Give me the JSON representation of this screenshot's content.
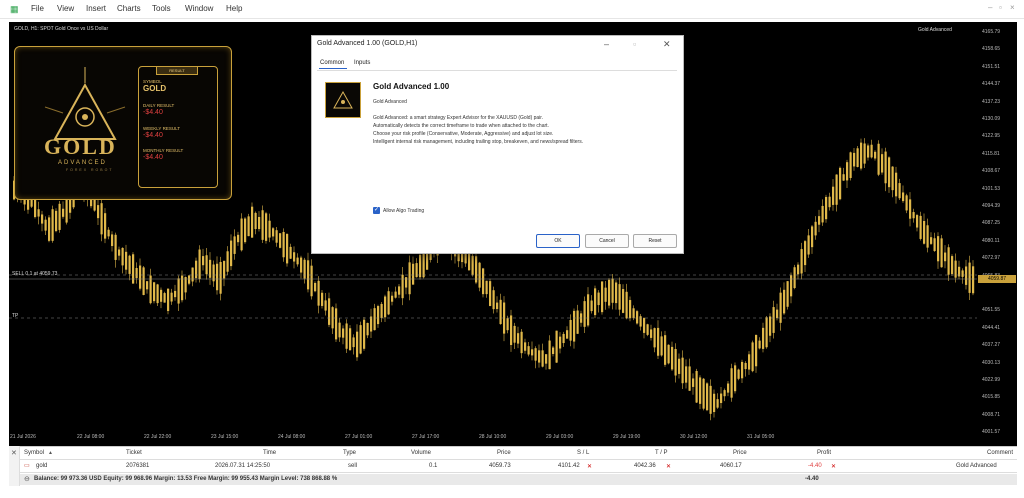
{
  "menu": {
    "items": [
      "File",
      "View",
      "Insert",
      "Charts",
      "Tools",
      "Window",
      "Help"
    ]
  },
  "chart": {
    "title": "GOLD, H1: SPOT Gold Once vs US Dollar",
    "ea_tag": "Gold Advanced",
    "price_labels": [
      "4165.79",
      "4158.65",
      "4151.51",
      "4144.37",
      "4137.23",
      "4130.09",
      "4122.95",
      "4115.81",
      "4108.67",
      "4101.53",
      "4094.39",
      "4087.25",
      "4080.11",
      "4072.97",
      "4065.83",
      "4051.55",
      "4044.41",
      "4037.27",
      "4030.13",
      "4022.99",
      "4015.85",
      "4008.71",
      "4001.57"
    ],
    "current_price": "4059.87",
    "date_labels": [
      "21 Jul 2026",
      "22 Jul 08:00",
      "22 Jul 22:00",
      "23 Jul 15:00",
      "24 Jul 08:00",
      "27 Jul 01:00",
      "27 Jul 17:00",
      "28 Jul 10:00",
      "29 Jul 03:00",
      "29 Jul 19:00",
      "30 Jul 12:00",
      "31 Jul 05:00"
    ],
    "sell_line_label": "SELL 0.1 at 4059.73",
    "tp_label": "TP"
  },
  "overlay": {
    "logo": "GOLD",
    "logo_sub": "ADVANCED",
    "logo_sub2": "FOREX ROBOT",
    "header": "RESULT",
    "symbol_label": "SYMBOL",
    "symbol_value": "GOLD",
    "daily_label": "DAILY RESULT",
    "daily_value": "-$4.40",
    "weekly_label": "WEEKLY RESULT",
    "weekly_value": "-$4.40",
    "monthly_label": "MONTHLY RESULT",
    "monthly_value": "-$4.40"
  },
  "dialog": {
    "title": "Gold Advanced 1.00 (GOLD,H1)",
    "tabs": [
      "Common",
      "Inputs"
    ],
    "ea_name": "Gold Advanced 1.00",
    "ea_sub": "Gold Advanced",
    "description": [
      "Gold Advanced: a smart strategy Expert Advisor for the XAUUSD (Gold) pair.",
      "Automatically detects the correct timeframe to trade when attached to the chart.",
      "Choose your risk profile (Conservative, Moderate, Aggressive) and adjust lot size.",
      "Intelligent internal risk management, including trailing stop, breakeven, and news/spread filters."
    ],
    "allow_algo": "Allow Algo Trading",
    "ok": "OK",
    "cancel": "Cancel",
    "reset": "Reset"
  },
  "trade": {
    "headers": {
      "symbol": "Symbol",
      "ticket": "Ticket",
      "time": "Time",
      "type": "Type",
      "volume": "Volume",
      "price": "Price",
      "sl": "S / L",
      "tp": "T / P",
      "cur_price": "Price",
      "profit": "Profit",
      "comment": "Comment"
    },
    "row": {
      "symbol": "gold",
      "ticket": "2076381",
      "time": "2026.07.31 14:25:50",
      "type": "sell",
      "volume": "0.1",
      "price": "4059.73",
      "sl": "4101.42",
      "tp": "4042.36",
      "cur_price": "4060.17",
      "profit": "-4.40",
      "comment": "Gold Advanced"
    },
    "balance": "Balance: 99 973.36 USD  Equity: 99 968.96  Margin: 13.53  Free Margin: 99 955.43  Margin Level: 738 868.88 %",
    "total_profit": "-4.40"
  },
  "colors": {
    "candle": "#e0b84a",
    "chart_bg": "#000000",
    "accent": "#2a62c8",
    "loss": "#e14040"
  }
}
